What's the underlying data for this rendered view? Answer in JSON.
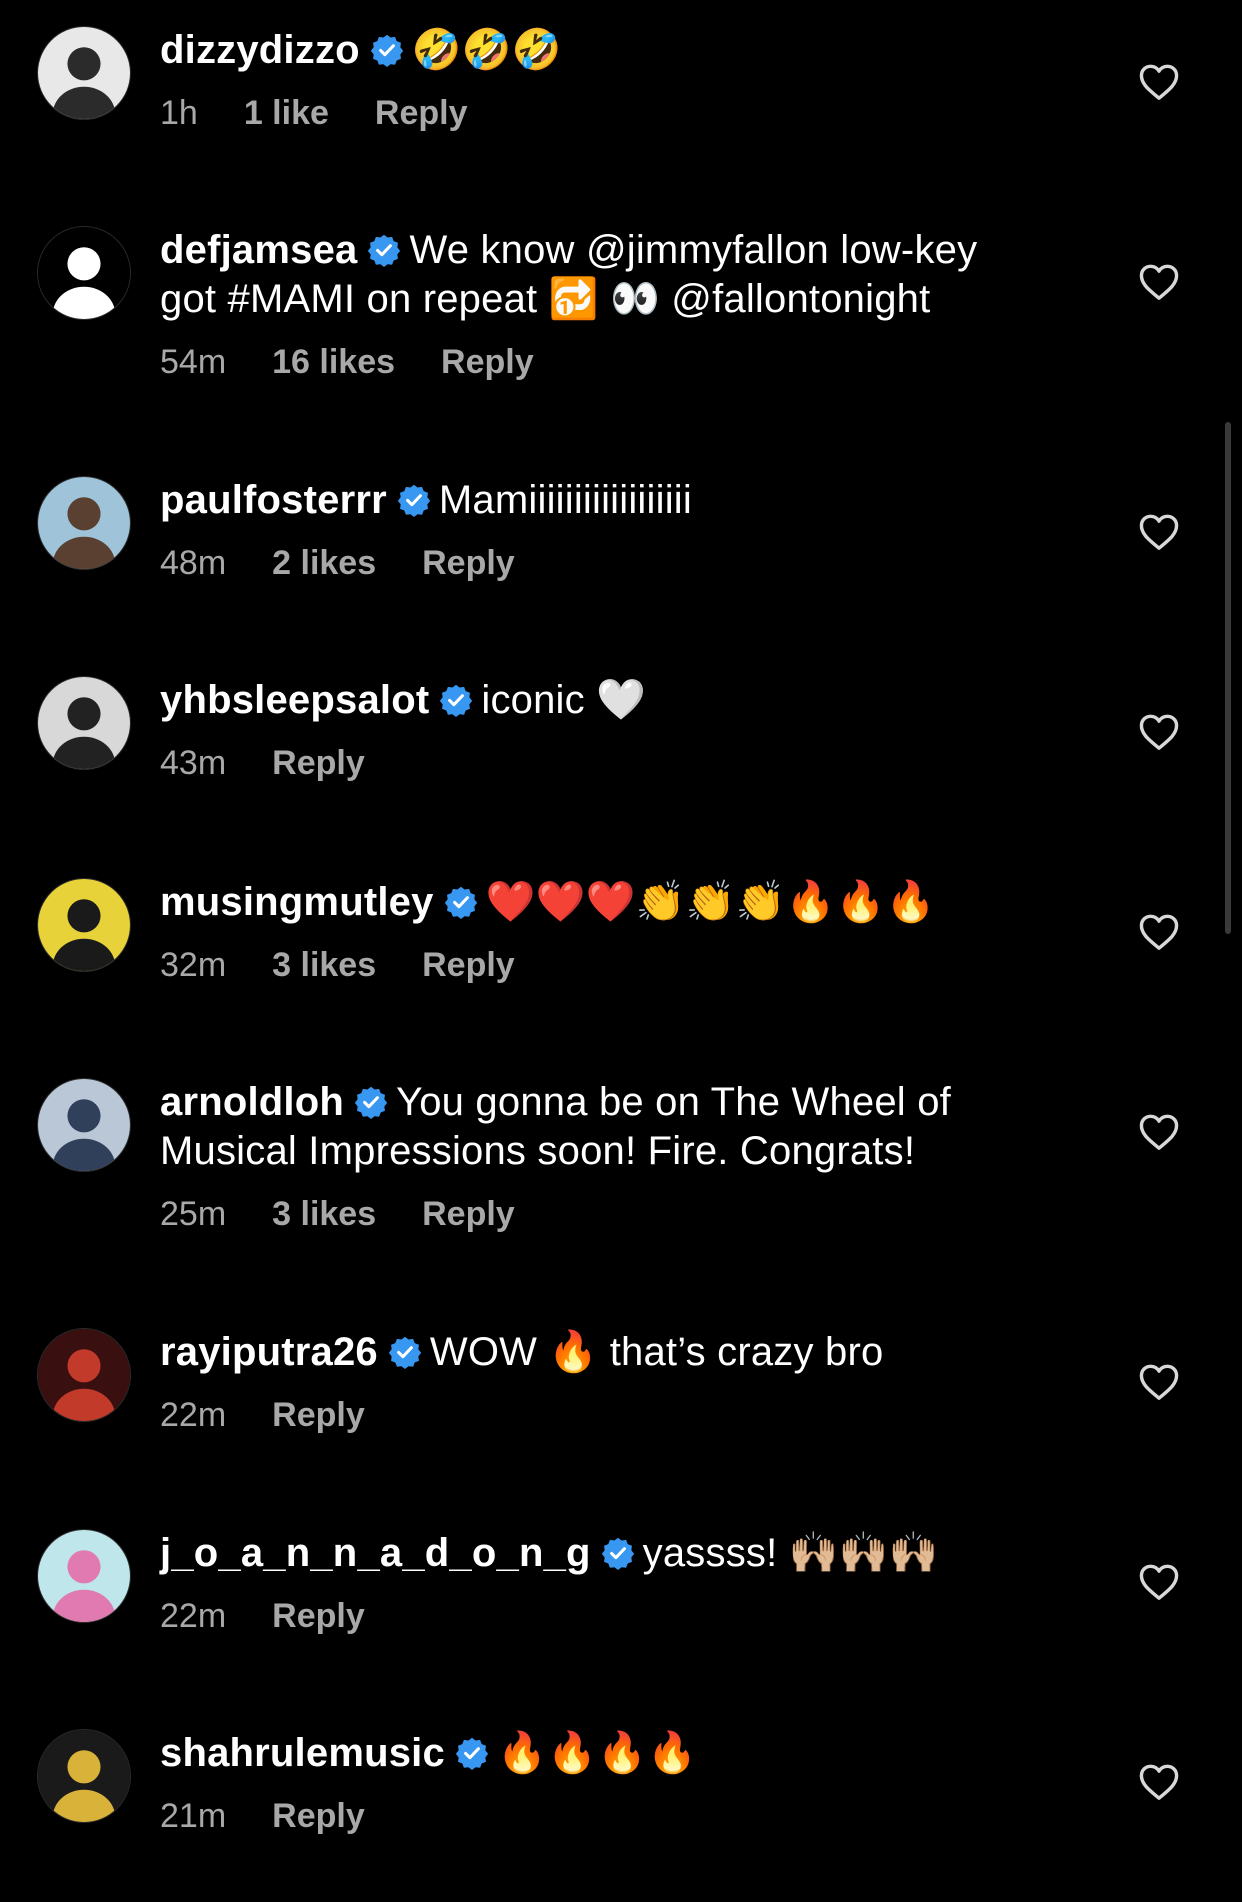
{
  "comments": [
    {
      "avatar": "dizzydizzo-avatar",
      "username": "dizzydizzo",
      "text": "🤣🤣🤣",
      "time": "1h",
      "likes": "1 like",
      "reply": "Reply"
    },
    {
      "avatar": "defjamsea-avatar",
      "username": "defjamsea",
      "text": "We know @jimmyfallon low-key got #MAMI on repeat 🔂 👀 @fallontonight",
      "time": "54m",
      "likes": "16 likes",
      "reply": "Reply"
    },
    {
      "avatar": "paulfosterrr-avatar",
      "username": "paulfosterrr",
      "text": "Mamiiiiiiiiiiiiiiiiii",
      "time": "48m",
      "likes": "2 likes",
      "reply": "Reply"
    },
    {
      "avatar": "yhbsleepsalot-avatar",
      "username": "yhbsleepsalot",
      "text": "iconic 🤍",
      "time": "43m",
      "likes": "",
      "reply": "Reply"
    },
    {
      "avatar": "musingmutley-avatar",
      "username": "musingmutley",
      "text": "❤️❤️❤️👏👏👏🔥🔥🔥",
      "time": "32m",
      "likes": "3 likes",
      "reply": "Reply"
    },
    {
      "avatar": "arnoldloh-avatar",
      "username": "arnoldloh",
      "text": "You gonna be on The Wheel of Musical Impressions soon! Fire. Congrats!",
      "time": "25m",
      "likes": "3 likes",
      "reply": "Reply"
    },
    {
      "avatar": "rayiputra26-avatar",
      "username": "rayiputra26",
      "text": "WOW 🔥 that’s crazy bro",
      "time": "22m",
      "likes": "",
      "reply": "Reply"
    },
    {
      "avatar": "j_o_a_n_n_a_d_o_n_g-avatar",
      "username": "j_o_a_n_n_a_d_o_n_g",
      "text": "yassss! 🙌🏼🙌🏼🙌🏼",
      "time": "22m",
      "likes": "",
      "reply": "Reply"
    },
    {
      "avatar": "shahrulemusic-avatar",
      "username": "shahrulemusic",
      "text": "🔥🔥🔥🔥",
      "time": "21m",
      "likes": "",
      "reply": "Reply"
    }
  ],
  "icons": {
    "verified": "verified-badge-icon",
    "like": "heart-outline-icon"
  },
  "colors": {
    "background": "#000000",
    "text": "#ffffff",
    "secondary": "#a8a8a8",
    "verified": "#3897f0"
  }
}
